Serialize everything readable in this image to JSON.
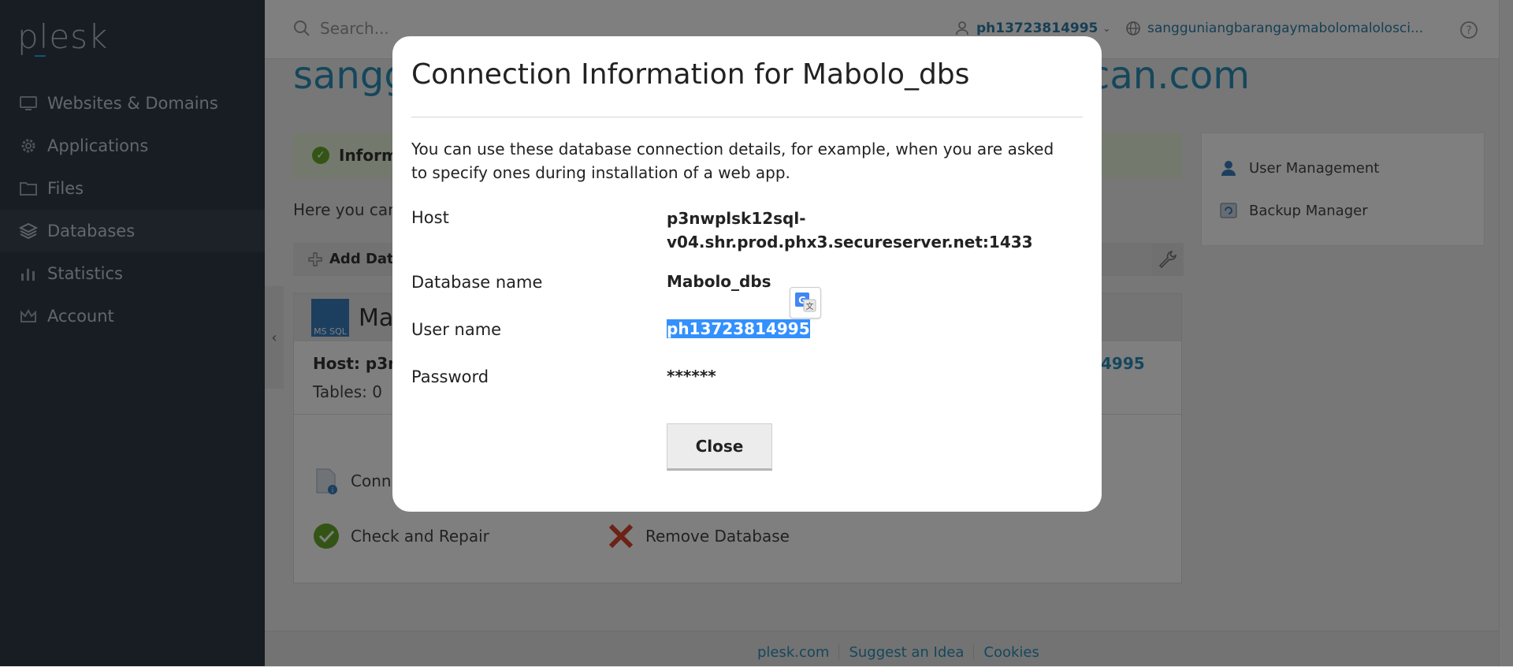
{
  "app": {
    "logo": "plesk"
  },
  "sidebar": {
    "items": [
      {
        "label": "Websites & Domains",
        "icon": "monitor-icon"
      },
      {
        "label": "Applications",
        "icon": "gear-icon"
      },
      {
        "label": "Files",
        "icon": "folder-icon"
      },
      {
        "label": "Databases",
        "icon": "database-layers-icon",
        "active": true
      },
      {
        "label": "Statistics",
        "icon": "bar-chart-icon"
      },
      {
        "label": "Account",
        "icon": "crown-icon"
      }
    ],
    "collapse_glyph": "‹"
  },
  "header": {
    "search_placeholder": "Search...",
    "user": "ph13723814995",
    "domain": "sangguniangbarangaymabolomalolosci..."
  },
  "page": {
    "title_start": "sangg",
    "title_end": "can.com",
    "info_label": "Inform",
    "intro_text": "Here you can",
    "add_db_label": "Add Data",
    "db_card": {
      "name": "Ma",
      "badge": "MS SQL",
      "host_label": "Host: p3nw",
      "user_link": "4995",
      "tables": "Tables: 0",
      "actions": {
        "connection_info": "Conn",
        "check_repair": "Check and Repair",
        "remove": "Remove Database"
      }
    }
  },
  "right_panel": {
    "items": [
      {
        "label": "User Management",
        "icon": "user-icon"
      },
      {
        "label": "Backup Manager",
        "icon": "backup-icon"
      }
    ]
  },
  "footer": {
    "links": [
      "plesk.com",
      "Suggest an Idea",
      "Cookies"
    ]
  },
  "modal": {
    "title": "Connection Information for Mabolo_dbs",
    "description": "You can use these database connection details, for example, when you are asked to specify ones during installation of a web app.",
    "rows": {
      "host": {
        "label": "Host",
        "value_line1": "p3nwplsk12sql-",
        "value_line2": "v04.shr.prod.phx3.secureserver.net:1433"
      },
      "db_name": {
        "label": "Database name",
        "value": "Mabolo_dbs"
      },
      "user": {
        "label": "User name",
        "value": "ph13723814995"
      },
      "password": {
        "label": "Password",
        "value": "******"
      }
    },
    "close_label": "Close"
  },
  "colors": {
    "sidebar_bg": "#2f3a46",
    "accent_link": "#2a8fb8",
    "selection": "#3390ff",
    "info_bg": "#e6f2da"
  }
}
